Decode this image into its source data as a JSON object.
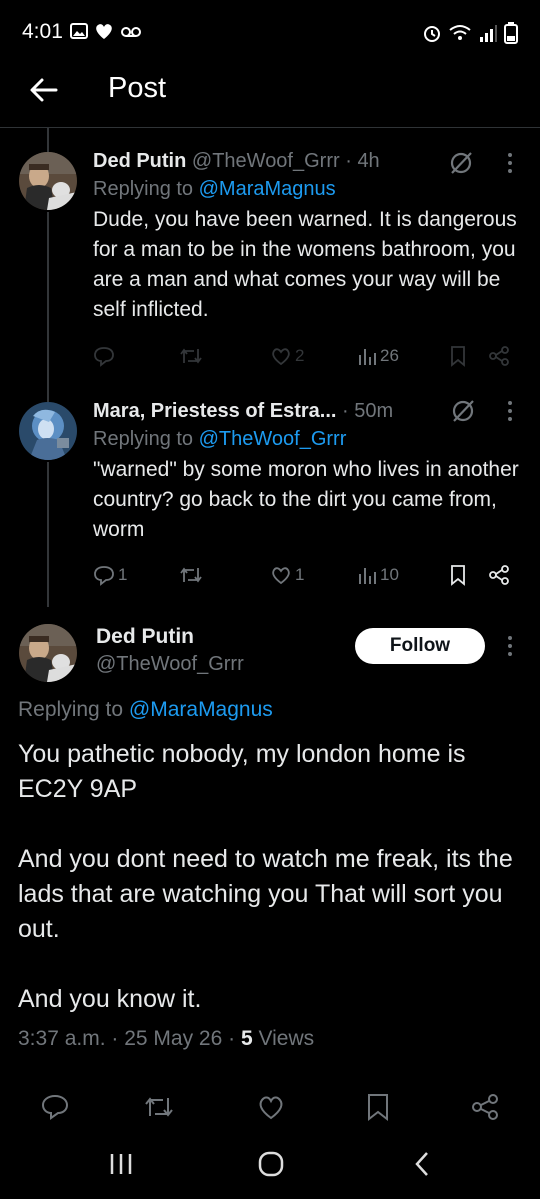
{
  "status_bar": {
    "time": "4:01",
    "battery_level": "2"
  },
  "header": {
    "title": "Post"
  },
  "replies": [
    {
      "name": "Ded Putin",
      "handle": "@TheWoof_Grrr",
      "time": "4h",
      "replying_prefix": "Replying to ",
      "replying_to": "@MaraMagnus",
      "body": "Dude, you have been warned. It is dangerous for a man to be in the womens bathroom, you are a man and what comes your way will be self inflicted.",
      "replies_count": "",
      "retweets_count": "",
      "likes_count": "2",
      "views_count": "26"
    },
    {
      "name": "Mara, Priestess of Estra...",
      "handle": "",
      "time": "50m",
      "replying_prefix": "Replying to ",
      "replying_to": "@TheWoof_Grrr",
      "body": "\"warned\" by some moron who lives in another country? go back to the dirt you came from, worm",
      "replies_count": "1",
      "retweets_count": "",
      "likes_count": "1",
      "views_count": "10"
    }
  ],
  "main_post": {
    "name": "Ded Putin",
    "handle": "@TheWoof_Grrr",
    "follow_label": "Follow",
    "replying_prefix": "Replying to ",
    "replying_to": "@MaraMagnus",
    "paragraphs": [
      "You pathetic nobody, my london home is EC2Y 9AP",
      "And you dont need to watch me freak, its the lads that are watching you That will sort you out.",
      "And you know it."
    ],
    "time": "3:37 a.m.",
    "date": "25 May 26",
    "views_count": "5",
    "views_label": "Views"
  },
  "colors": {
    "background": "#000000",
    "text": "#e7e9ea",
    "muted": "#71767b",
    "link": "#1d9bf0",
    "divider": "#2f3336"
  },
  "icons": [
    "back-arrow-icon",
    "grok-icon",
    "more-icon",
    "reply-icon",
    "retweet-icon",
    "like-icon",
    "views-icon",
    "bookmark-icon",
    "share-icon"
  ]
}
